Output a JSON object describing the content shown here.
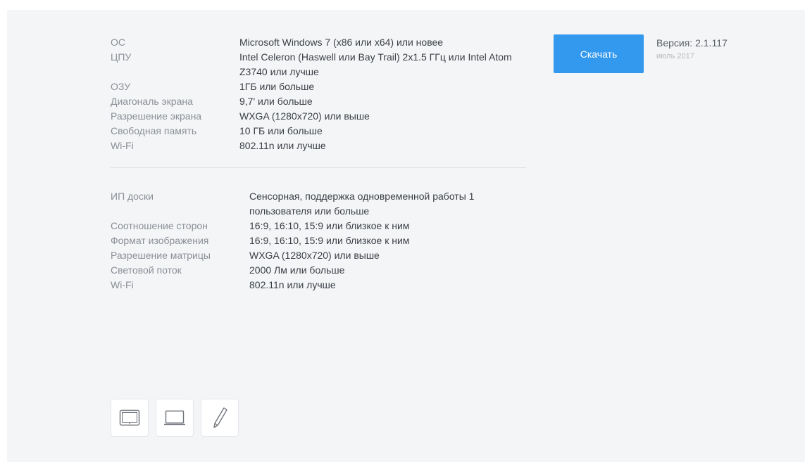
{
  "requirements": {
    "system": [
      {
        "label": "ОС",
        "value": "Microsoft Windows 7 (x86 или x64) или новее"
      },
      {
        "label": "ЦПУ",
        "value": "Intel Celeron (Haswell или Bay Trail) 2x1.5 ГГц или Intel Atom Z3740 или лучше"
      },
      {
        "label": "ОЗУ",
        "value": "1ГБ или больше"
      },
      {
        "label": "Диагональ экрана",
        "value": "9,7' или больше"
      },
      {
        "label": "Разрешение экрана",
        "value": "WXGA (1280x720) или выше"
      },
      {
        "label": "Свободная память",
        "value": "10 ГБ или больше"
      },
      {
        "label": "Wi-Fi",
        "value": "802.11n или лучше"
      }
    ],
    "board": [
      {
        "label": "ИП доски",
        "value": "Сенсорная, поддержка одновременной работы 1 пользователя или больше"
      },
      {
        "label": "Соотношение сторон",
        "value": "16:9, 16:10, 15:9 или близкое к ним"
      },
      {
        "label": "Формат изображения",
        "value": "16:9, 16:10, 15:9 или близкое к ним"
      },
      {
        "label": "Разрешение матрицы",
        "value": "WXGA (1280x720) или выше"
      },
      {
        "label": "Световой поток",
        "value": "2000 Лм или больше"
      },
      {
        "label": "Wi-Fi",
        "value": "802.11n или лучше"
      }
    ]
  },
  "download": {
    "button_label": "Скачать",
    "version": "Версия: 2.1.117",
    "date": "июль 2017"
  },
  "devices": [
    {
      "icon": "tablet-icon"
    },
    {
      "icon": "laptop-icon"
    },
    {
      "icon": "pen-icon"
    }
  ],
  "colors": {
    "accent": "#3399ee",
    "panel_bg": "#f4f5f7"
  }
}
